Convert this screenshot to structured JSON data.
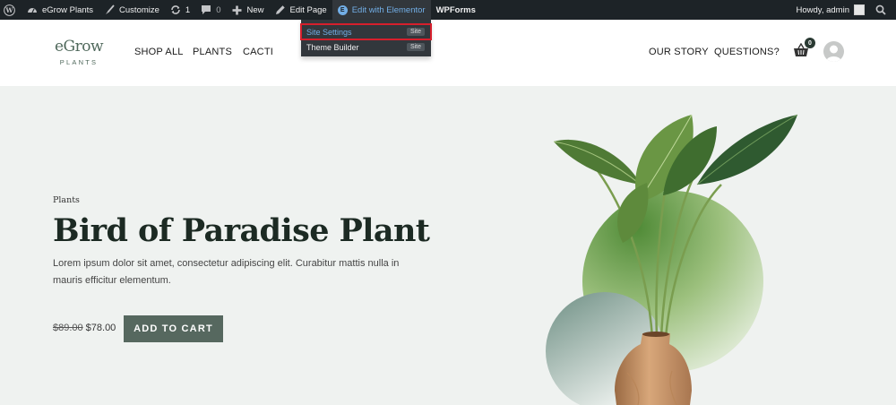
{
  "adminbar": {
    "site_name": "eGrow Plants",
    "customize": "Customize",
    "updates_count": "1",
    "comments_count": "0",
    "new_label": "New",
    "edit_page": "Edit Page",
    "edit_elementor": "Edit with Elementor",
    "wpforms": "WPForms",
    "howdy": "Howdy, admin"
  },
  "dropdown": {
    "items": [
      {
        "label": "Site Settings",
        "badge": "Site"
      },
      {
        "label": "Theme Builder",
        "badge": "Site"
      }
    ]
  },
  "header": {
    "logo_main": "eGrow",
    "logo_sub": "PLANTS",
    "nav": [
      "SHOP ALL",
      "PLANTS",
      "CACTI"
    ],
    "nav_right": [
      "OUR STORY",
      "QUESTIONS?"
    ],
    "cart_count": "0"
  },
  "hero": {
    "category": "Plants",
    "title": "Bird of Paradise Plant",
    "description": "Lorem ipsum dolor sit amet, consectetur adipiscing elit. Curabitur mattis nulla in mauris efficitur elementum.",
    "old_price": "$89.00",
    "price": "$78.00",
    "button": "ADD TO CART"
  },
  "colors": {
    "adminbar_bg": "#1d2327",
    "accent_link": "#72aee6",
    "highlight_red": "#d61f2c",
    "brand_green": "#56685f",
    "hero_bg": "#eff2f0"
  }
}
